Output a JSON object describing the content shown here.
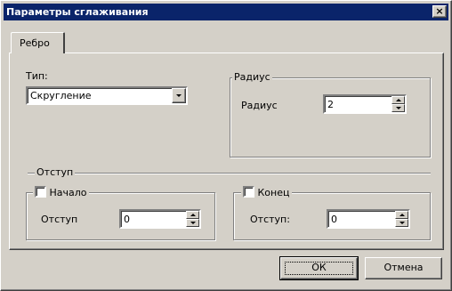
{
  "window": {
    "title": "Параметры сглаживания",
    "close_glyph": "×"
  },
  "tabs": [
    {
      "label": "Ребро"
    }
  ],
  "type": {
    "label": "Тип:",
    "value": "Скругление"
  },
  "radius_group": {
    "title": "Радиус",
    "field_label": "Радиус",
    "value": "2"
  },
  "offset_section": {
    "title": "Отступ"
  },
  "start_group": {
    "checkbox_label": "Начало",
    "checked": false,
    "field_label": "Отступ",
    "value": "0"
  },
  "end_group": {
    "checkbox_label": "Конец",
    "checked": false,
    "field_label": "Отступ:",
    "value": "0"
  },
  "buttons": {
    "ok": "ОК",
    "cancel": "Отмена"
  }
}
